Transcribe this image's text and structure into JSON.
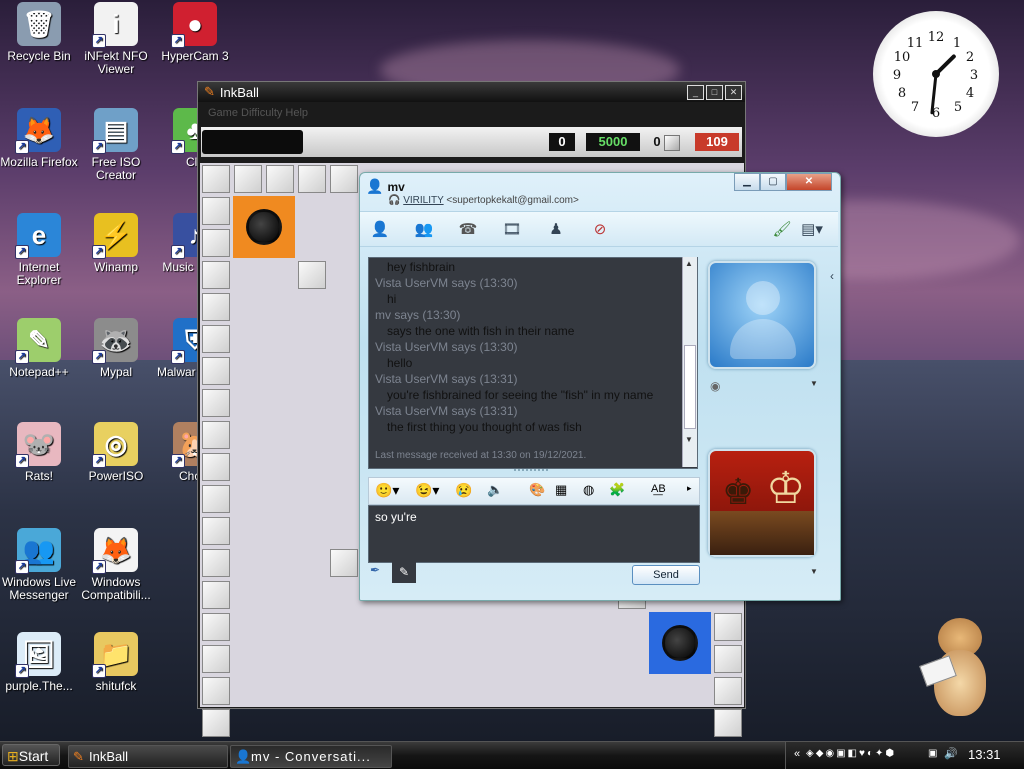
{
  "desktop": {
    "icons": [
      {
        "label": "Recycle Bin",
        "glyph": "🗑",
        "bg": "#8a9cb0"
      },
      {
        "label": "iNFekt NFO Viewer",
        "glyph": "i",
        "bg": "#f2f2f2"
      },
      {
        "label": "HyperCam 3",
        "glyph": "●",
        "bg": "#d02030"
      },
      {
        "label": "Mozilla Firefox",
        "glyph": "🦊",
        "bg": "#2f5fb5"
      },
      {
        "label": "Free ISO Creator",
        "glyph": "▤",
        "bg": "#6fa0c8"
      },
      {
        "label": "Clo",
        "glyph": "♣",
        "bg": "#5db94a"
      },
      {
        "label": "Internet Explorer",
        "glyph": "e",
        "bg": "#2b86d8"
      },
      {
        "label": "Winamp",
        "glyph": "⚡",
        "bg": "#e8c020"
      },
      {
        "label": "Music JUKE",
        "glyph": "♪",
        "bg": "#3850a0"
      },
      {
        "label": "Notepad++",
        "glyph": "✎",
        "bg": "#9dce6c"
      },
      {
        "label": "Mypal",
        "glyph": "🦝",
        "bg": "#8c8c8c"
      },
      {
        "label": "Malwar Anti-M",
        "glyph": "⛨",
        "bg": "#2070c8"
      },
      {
        "label": "Rats!",
        "glyph": "🐭",
        "bg": "#e8b8c0"
      },
      {
        "label": "PowerISO",
        "glyph": "◎",
        "bg": "#e8d060"
      },
      {
        "label": "Chom",
        "glyph": "🐹",
        "bg": "#b08060"
      },
      {
        "label": "Windows Live Messenger",
        "glyph": "👥",
        "bg": "#4aa8d8"
      },
      {
        "label": "Windows Compatibili...",
        "glyph": "🦊",
        "bg": "#f4f4f4"
      },
      {
        "label": "purple.The...",
        "glyph": "🖼",
        "bg": "#dcecf8"
      },
      {
        "label": "shitufck",
        "glyph": "📁",
        "bg": "#e8c860"
      }
    ]
  },
  "clock": {
    "label": "analog desktop clock",
    "hour": 1,
    "minute": 31
  },
  "inkball": {
    "title": "InkBall",
    "menu_faded": "Game  Difficulty  Help",
    "black_counter": "0",
    "score": "5000",
    "gray_counter": "0",
    "timer": "109"
  },
  "messenger": {
    "contact_name": "mv",
    "status_word": "VIRILITY",
    "email": "<supertopkekalt@gmail.com>",
    "messages": [
      {
        "text": "hey fishbrain",
        "kind": "msg"
      },
      {
        "text": "Vista UserVM says (13:30)",
        "kind": "header"
      },
      {
        "text": "hi",
        "kind": "msg"
      },
      {
        "text": "mv says (13:30)",
        "kind": "header"
      },
      {
        "text": "says the one with fish in their name",
        "kind": "msg"
      },
      {
        "text": "Vista UserVM says (13:30)",
        "kind": "header"
      },
      {
        "text": "hello",
        "kind": "msg"
      },
      {
        "text": "Vista UserVM says (13:31)",
        "kind": "header"
      },
      {
        "text": "you're fishbrained for seeing the \"fish\" in my name",
        "kind": "msg"
      },
      {
        "text": "Vista UserVM says (13:31)",
        "kind": "header"
      },
      {
        "text": "the first thing you thought of was fish",
        "kind": "msg"
      }
    ],
    "last_received": "Last message received at 13:30 on 19/12/2021.",
    "input_text": "so yu're",
    "send_label": "Send"
  },
  "taskbar": {
    "start_label": "Start",
    "items": [
      {
        "label": "InkBall"
      },
      {
        "label": "mv - Conversati..."
      }
    ],
    "time": "13:31"
  }
}
